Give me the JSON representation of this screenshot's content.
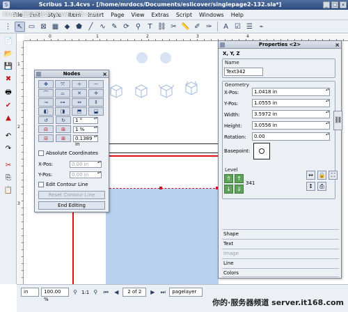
{
  "window": {
    "title": "Scribus 1.3.4cvs - [/home/mrdocs/Documents/eslicover/singlepage2-132.sla*]",
    "buttons": [
      "_",
      "□",
      "×"
    ]
  },
  "menu": [
    "File",
    "Edit",
    "Style",
    "Item",
    "Insert",
    "Page",
    "View",
    "Extras",
    "Script",
    "Windows",
    "Help"
  ],
  "toolbar_icons": [
    "select",
    "text",
    "image",
    "table",
    "shape",
    "polygon",
    "line",
    "bezier",
    "freehand",
    "rotate",
    "zoom",
    "edit-text",
    "link",
    "unlink",
    "measure",
    "copy-properties",
    "eyedropper",
    "pdf-push",
    "pdf-check"
  ],
  "left_toolbar_icons": [
    "new",
    "open",
    "save",
    "close",
    "print",
    "pdf",
    "undo",
    "redo",
    "cut",
    "copy",
    "paste"
  ],
  "hruler_numbers": [
    "0",
    "1",
    "2",
    "3",
    "4"
  ],
  "vruler_numbers": [
    "1",
    "2",
    "3"
  ],
  "nodes_palette": {
    "title": "Nodes",
    "node_buttons": [
      "move",
      "add",
      "delete",
      "reset",
      "split",
      "connect",
      "mirror-h",
      "mirror-v",
      "shear-l",
      "shear-r",
      "shear-u",
      "shear-d",
      "rot-l",
      "rot-r",
      "shrink",
      "grow"
    ],
    "rotation_value": "1 °",
    "scale_value": "1 %",
    "offset_value": "0.1389 in",
    "absolute_label": "Absolute Coordinates",
    "xpos_label": "X-Pos:",
    "xpos_value": "0.00 in",
    "ypos_label": "Y-Pos:",
    "ypos_value": "0.00 in",
    "contour_label": "Edit Contour Line",
    "reset_contour": "Reset Contour Line",
    "end_editing": "End Editing"
  },
  "properties": {
    "title": "Properties <2>",
    "tab": "X, Y, Z",
    "name_label": "Name",
    "name_value": "Text342",
    "geometry_label": "Geometry",
    "xpos_label": "X-Pos:",
    "xpos_value": "1.0418 in",
    "ypos_label": "Y-Pos:",
    "ypos_value": "1.0555 in",
    "width_label": "Width:",
    "width_value": "3.5972 in",
    "height_label": "Height:",
    "height_value": "3.0556 in",
    "rotation_label": "Rotation:",
    "rotation_value": "0.00",
    "basepoint_label": "Basepoint:",
    "level_label": "Level",
    "level_value": "341",
    "sections": [
      "Shape",
      "Text",
      "Image",
      "Line",
      "Colors"
    ]
  },
  "statusbar": {
    "unit": "in",
    "zoom": "100.00 %",
    "ratio": "1:1",
    "page": "2 of 2",
    "layer": "pagelayer"
  },
  "watermark": {
    "top": "Kinder-服务器技术 (www.it168.com)",
    "bottom": "你的·服务器频道  server.it168.com"
  }
}
